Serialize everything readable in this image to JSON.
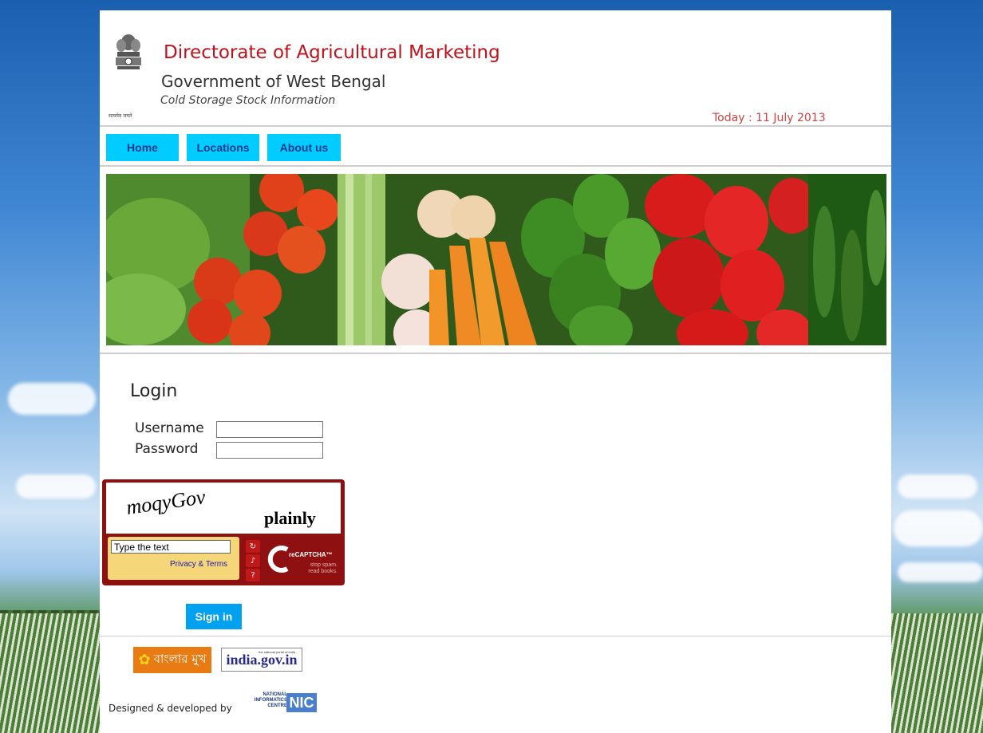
{
  "header": {
    "title": "Directorate of Agricultural Marketing",
    "subtitle": "Government of West Bengal",
    "tagline": "Cold Storage Stock Information",
    "date_text": "Today : 11 July 2013",
    "emblem_motto": "सत्यमेव जयते"
  },
  "nav": {
    "items": [
      {
        "label": "Home"
      },
      {
        "label": "Locations"
      },
      {
        "label": "About us"
      }
    ]
  },
  "login": {
    "heading": "Login",
    "username_label": "Username",
    "password_label": "Password",
    "username_value": "",
    "password_value": "",
    "signin_label": "Sign in"
  },
  "captcha": {
    "word1": "moqyGov",
    "word2": "plainly",
    "input_value": "Type the text",
    "privacy_link": "Privacy & Terms",
    "brand": "reCAPTCHA™",
    "brand_sub1": "stop spam.",
    "brand_sub2": "read books."
  },
  "footer": {
    "banglar_mukh": "বাংলার মুখ",
    "india_gov": "india.gov.in",
    "india_gov_tag": "the national portal of india",
    "designed_by": "Designed & developed by",
    "nic_small": "NATIONAL INFORMATICS CENTRE",
    "nic_logo": "NIC"
  }
}
